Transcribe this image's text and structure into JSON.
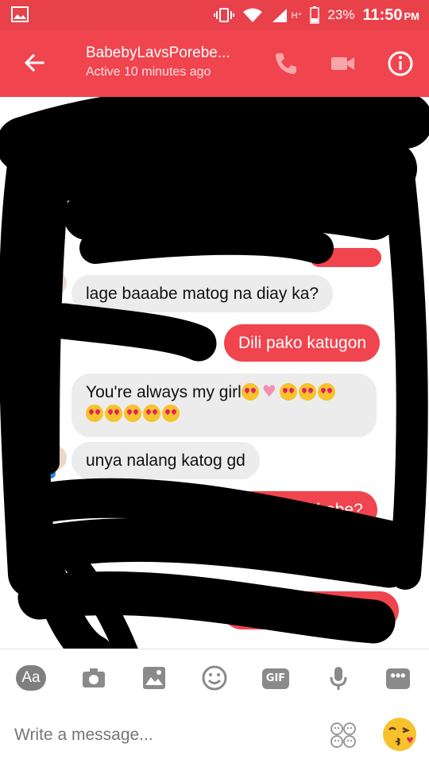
{
  "status_bar": {
    "network": "H⁺",
    "battery": "23%",
    "time": "11:50",
    "ampm": "PM"
  },
  "header": {
    "title": "BabebyLavsPorebe...",
    "subtitle": "Active 10 minutes ago"
  },
  "messages": [
    {
      "side": "in",
      "text": "lage baaabe matog na diay ka?"
    },
    {
      "side": "out",
      "text": "Dili pako katugon"
    },
    {
      "side": "in",
      "text": "You're always my girl"
    },
    {
      "side": "in",
      "text": "unya nalang katog gd"
    },
    {
      "side": "out",
      "text": "What kind of girl babe?"
    }
  ],
  "composer": {
    "aa_label": "Aa",
    "gif_label": "GIF",
    "more_label": "•••",
    "placeholder": "Write a message..."
  },
  "colors": {
    "accent": "#f0444e",
    "status_bar": "#e8414a",
    "incoming_bubble": "#ececec",
    "redaction": "#000000"
  },
  "icons": [
    "image-icon",
    "back-arrow-icon",
    "phone-icon",
    "video-icon",
    "info-icon",
    "camera-icon",
    "gallery-icon",
    "smiley-icon",
    "mic-icon",
    "sticker-icon",
    "kissing-emoji-icon",
    "messenger-badge-icon"
  ]
}
